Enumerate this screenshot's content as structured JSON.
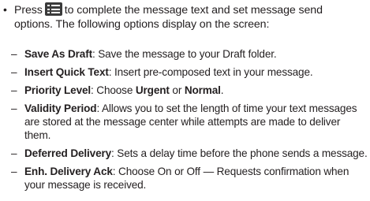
{
  "intro": {
    "bullet": "•",
    "before_icon": "Press",
    "icon": "menu-key-icon",
    "after_icon_line1": "to complete the message text and set message send",
    "line2": "options. The following options display on the screen:"
  },
  "options": [
    {
      "dash": "–",
      "term": "Save As Draft",
      "desc": ": Save the message to your Draft folder."
    },
    {
      "dash": "–",
      "term": "Insert Quick Text",
      "desc": ": Insert pre-composed text in your message."
    },
    {
      "dash": "–",
      "term": "Priority Level",
      "desc_a": ": Choose ",
      "opt1": "Urgent",
      "desc_b": " or ",
      "opt2": "Normal",
      "desc_c": "."
    },
    {
      "dash": "–",
      "term": "Validity Period",
      "desc": ": Allows you to set the length of time your text messages are stored at the message center while attempts are made to deliver them."
    },
    {
      "dash": "–",
      "term": "Deferred Delivery",
      "desc": ": Sets a delay time before the phone sends a message."
    },
    {
      "dash": "–",
      "term": "Enh. Delivery Ack",
      "desc": ": Choose On or Off — Requests confirmation when your message is received."
    }
  ]
}
